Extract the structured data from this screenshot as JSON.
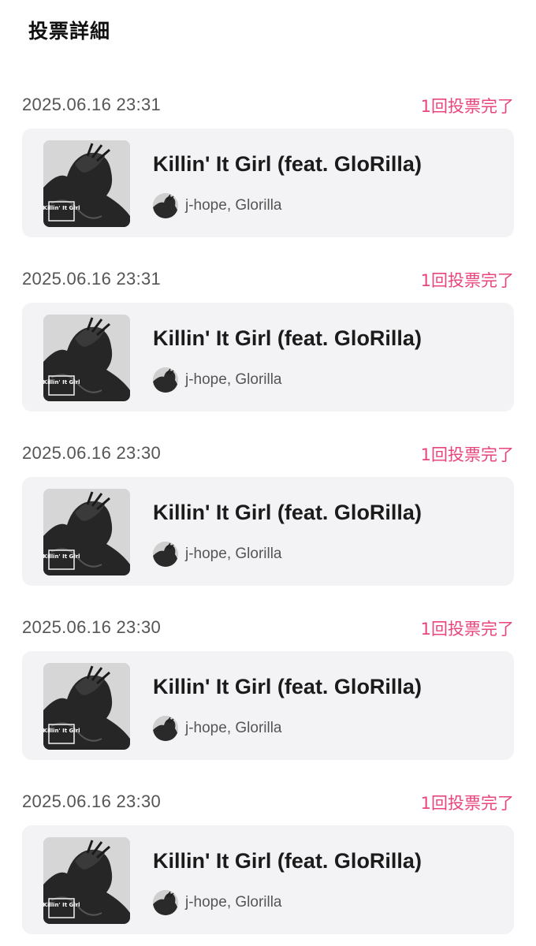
{
  "header": {
    "title": "投票詳細"
  },
  "votes": [
    {
      "time": "2025.06.16 23:31",
      "status": "1回投票完了",
      "song": {
        "title": "Killin' It Girl (feat. GloRilla)",
        "artist": "j-hope, Glorilla",
        "art_label": "Killin' It Girl"
      }
    },
    {
      "time": "2025.06.16 23:31",
      "status": "1回投票完了",
      "song": {
        "title": "Killin' It Girl (feat. GloRilla)",
        "artist": "j-hope, Glorilla",
        "art_label": "Killin' It Girl"
      }
    },
    {
      "time": "2025.06.16 23:30",
      "status": "1回投票完了",
      "song": {
        "title": "Killin' It Girl (feat. GloRilla)",
        "artist": "j-hope, Glorilla",
        "art_label": "Killin' It Girl"
      }
    },
    {
      "time": "2025.06.16 23:30",
      "status": "1回投票完了",
      "song": {
        "title": "Killin' It Girl (feat. GloRilla)",
        "artist": "j-hope, Glorilla",
        "art_label": "Killin' It Girl"
      }
    },
    {
      "time": "2025.06.16 23:30",
      "status": "1回投票完了",
      "song": {
        "title": "Killin' It Girl (feat. GloRilla)",
        "artist": "j-hope, Glorilla",
        "art_label": "Killin' It Girl"
      }
    }
  ],
  "colors": {
    "status_accent": "#e8457e",
    "card_background": "#f3f3f5",
    "timestamp_text": "#555555"
  }
}
